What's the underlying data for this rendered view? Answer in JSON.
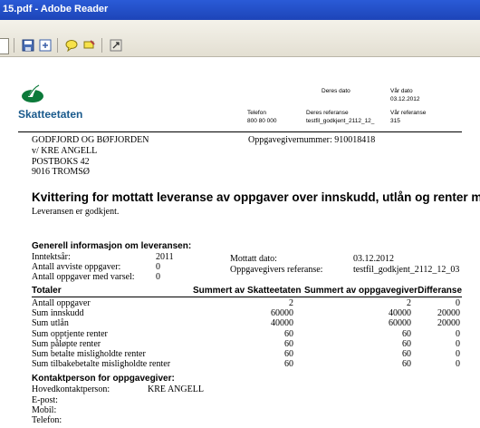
{
  "window": {
    "title": "15.pdf - Adobe Reader"
  },
  "toolbar": {
    "icons": [
      "save-icon",
      "export-icon",
      "comment-icon",
      "highlight-icon",
      "expand-icon"
    ]
  },
  "header": {
    "logo_text": "Skatteetaten",
    "deres_dato_label": "Deres dato",
    "var_dato_label": "Vår dato",
    "var_dato_value": "03.12.2012",
    "telefon_label": "Telefon",
    "telefon_value": "800 80 000",
    "deres_referanse_label": "Deres referanse",
    "deres_referanse_value": "testfil_godkjent_2112_12_",
    "var_referanse_label": "Vår referanse",
    "var_referanse_value": "315"
  },
  "address": {
    "line1": "GODFJORD OG BØFJORDEN",
    "line2": "v/ KRE ANGELL",
    "line3": "POSTBOKS 42",
    "line4": "9016   TROMSØ",
    "oppgavegiver": "Oppgavegivernummer: 910018418"
  },
  "title": "Kvittering for mottatt leveranse av oppgaver over innskudd, utlån og renter mv",
  "status_text": "Leveransen er godkjent.",
  "general": {
    "heading": "Generell informasjon om leveransen:",
    "inntektsar_label": "Inntektsår:",
    "inntektsar_value": "2011",
    "avviste_label": "Antall avviste oppgaver:",
    "avviste_value": "0",
    "varsel_label": "Antall oppgaver med varsel:",
    "varsel_value": "0",
    "mottatt_label": "Mottatt dato:",
    "mottatt_value": "03.12.2012",
    "referanse_label": "Oppgavegivers referanse:",
    "referanse_value": "testfil_godkjent_2112_12_03"
  },
  "totals": {
    "headers": [
      "Totaler",
      "Summert av Skatteetaten",
      "Summert av oppgavegiver",
      "Differanse"
    ],
    "rows": [
      [
        "Antall oppgaver",
        "2",
        "2",
        "0"
      ],
      [
        "Sum innskudd",
        "60000",
        "40000",
        "20000"
      ],
      [
        "Sum utlån",
        "40000",
        "60000",
        "20000"
      ],
      [
        "Sum opptjente renter",
        "60",
        "60",
        "0"
      ],
      [
        "Sum påløpte renter",
        "60",
        "60",
        "0"
      ],
      [
        "Sum betalte misligholdte renter",
        "60",
        "60",
        "0"
      ],
      [
        "Sum tilbakebetalte misligholdte renter",
        "60",
        "60",
        "0"
      ]
    ]
  },
  "contact": {
    "heading": "Kontaktperson for oppgavegiver:",
    "hoved_label": "Hovedkontaktperson:",
    "hoved_value": "KRE ANGELL",
    "epost_label": "E-post:",
    "mobil_label": "Mobil:",
    "telefon_label": "Telefon:"
  }
}
